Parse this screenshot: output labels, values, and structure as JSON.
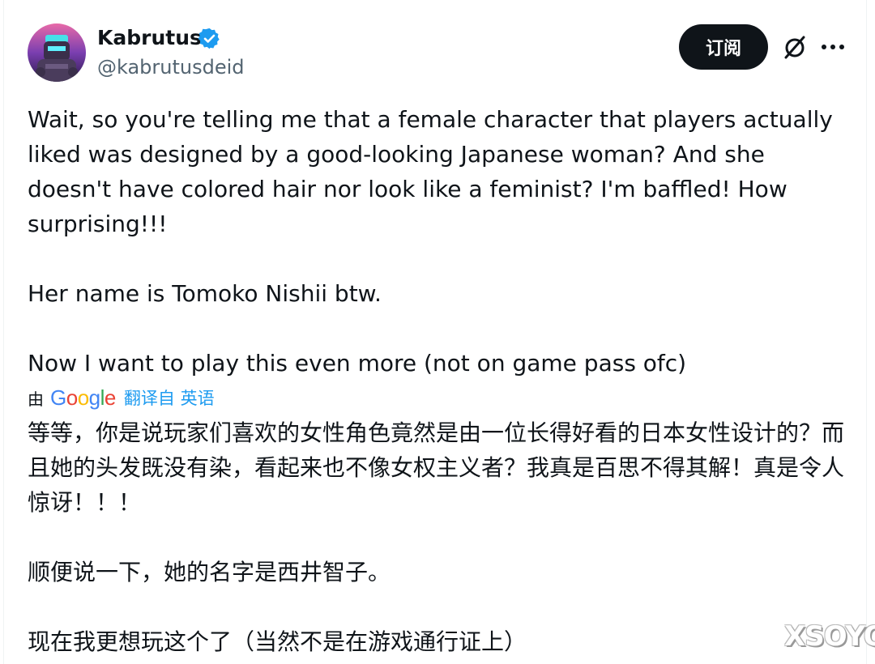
{
  "author": {
    "display_name": "Kabrutus",
    "handle": "@kabrutusdeid",
    "verified": true,
    "verified_color": "#1d9bf0"
  },
  "actions": {
    "subscribe_label": "订阅",
    "grok_icon": "grok-icon",
    "more_icon": "more-icon"
  },
  "tweet": {
    "paragraphs": [
      "Wait, so you're telling me that a female character that players actually liked was designed by a good-looking Japanese woman? And she doesn't have colored hair nor look like a feminist? I'm baffled! How surprising!!!",
      "Her name is Tomoko Nishii btw.",
      "Now I want to play this even more (not on game pass ofc)"
    ]
  },
  "translation": {
    "by_label": "由",
    "provider": "Google",
    "from_label": "翻译自 英语",
    "paragraphs": [
      "等等，你是说玩家们喜欢的女性角色竟然是由一位长得好看的日本女性设计的？而且她的头发既没有染，看起来也不像女权主义者？我真是百思不得其解！真是令人惊讶！！！",
      "顺便说一下，她的名字是西井智子。",
      "现在我更想玩这个了（当然不是在游戏通行证上）"
    ]
  },
  "watermark": "XSOYO"
}
